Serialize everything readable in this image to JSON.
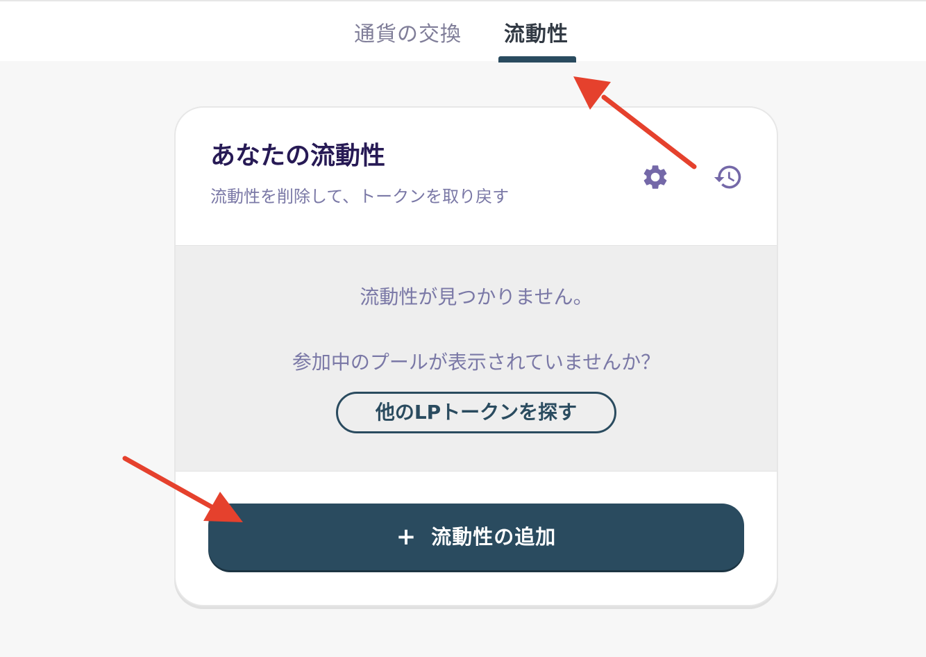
{
  "tabs": {
    "swap_label": "通貨の交換",
    "liquidity_label": "流動性",
    "active": "liquidity"
  },
  "card": {
    "title": "あなたの流動性",
    "subtitle": "流動性を削除して、トークンを取り戻す",
    "settings_icon": "gear-icon",
    "history_icon": "history-icon"
  },
  "empty_state": {
    "message": "流動性が見つかりません。",
    "hint": "参加中のプールが表示されていませんか？",
    "find_button_label": "他のLPトークンを探す"
  },
  "add_button": {
    "plus": "+",
    "label": "流動性の追加"
  },
  "colors": {
    "accent": "#2a4b5f",
    "title": "#271a55",
    "muted_text": "#7a78a6",
    "icon": "#7468a8",
    "annotation_arrow": "#e5412d"
  }
}
